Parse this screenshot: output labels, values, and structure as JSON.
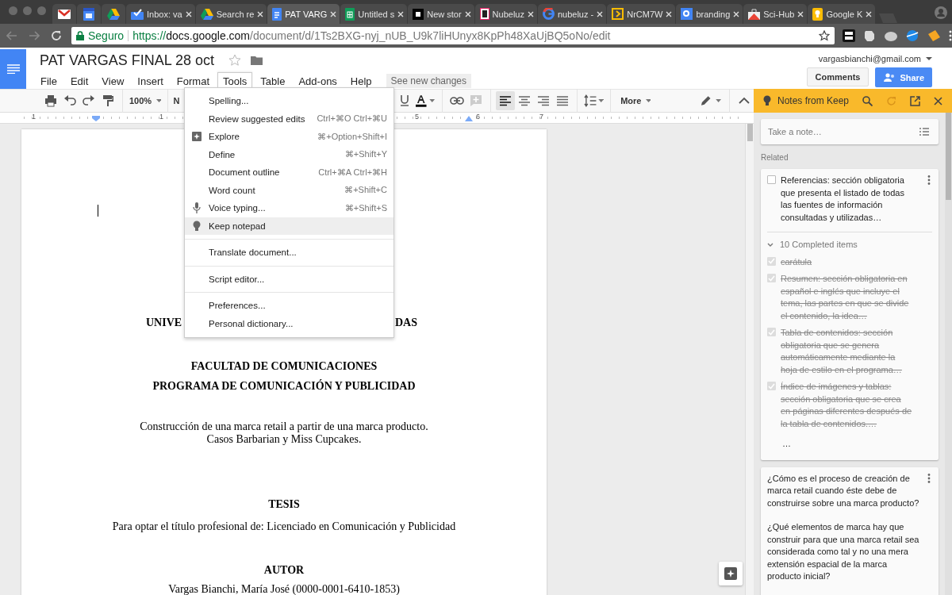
{
  "browser": {
    "tabs": [
      {
        "kind": "gmail",
        "selected": false
      },
      {
        "kind": "calendar",
        "selected": false
      },
      {
        "kind": "drive",
        "selected": false
      },
      {
        "kind": "inbox",
        "title": "Inbox: va",
        "selected": false
      },
      {
        "kind": "drive",
        "title": "Search re",
        "selected": false
      },
      {
        "kind": "docs",
        "title": "PAT VARG",
        "selected": true
      },
      {
        "kind": "sheets",
        "title": "Untitled s",
        "selected": false
      },
      {
        "kind": "medium",
        "title": "New stor",
        "selected": false
      },
      {
        "kind": "nubeluz",
        "title": "Nubeluz",
        "selected": false
      },
      {
        "kind": "google",
        "title": "nubeluz -",
        "selected": false
      },
      {
        "kind": "slides",
        "title": "NrCM7W",
        "selected": false
      },
      {
        "kind": "gsearch",
        "title": "branding",
        "selected": false
      },
      {
        "kind": "scihub",
        "title": "Sci-Hub",
        "selected": false
      },
      {
        "kind": "keep",
        "title": "Google K",
        "selected": false
      }
    ],
    "security": "Seguro",
    "url": {
      "scheme": "https://",
      "host": "docs.google.com",
      "path": "/document/d/1Ts2BXG-nyj_nUB_U9k7liHUnyx8KpPh48XaUjBQ5oNo/edit"
    }
  },
  "document": {
    "title": "PAT VARGAS FINAL 28 oct",
    "starred": false,
    "menus": [
      {
        "label": "File",
        "selected": false
      },
      {
        "label": "Edit",
        "selected": false
      },
      {
        "label": "View",
        "selected": false
      },
      {
        "label": "Insert",
        "selected": false
      },
      {
        "label": "Format",
        "selected": false
      },
      {
        "label": "Tools",
        "selected": true
      },
      {
        "label": "Table",
        "selected": false
      },
      {
        "label": "Add-ons",
        "selected": false
      },
      {
        "label": "Help",
        "selected": false
      }
    ],
    "notice": "See new changes",
    "account": "vargasbianchi@gmail.com",
    "comments": "Comments",
    "share": "Share"
  },
  "toolbar": {
    "zoom": "100%",
    "style": "N",
    "more": "More",
    "alignment": [
      {
        "selected": true
      },
      {
        "selected": false
      },
      {
        "selected": false
      },
      {
        "selected": false
      }
    ]
  },
  "ruler": [
    "1",
    "1",
    "5",
    "6",
    "7"
  ],
  "tools_menu": {
    "groups": [
      [
        {
          "kind": "plain",
          "label": "Spelling...",
          "selected": false
        },
        {
          "kind": "plain",
          "label": "Review suggested edits",
          "shortcut": "Ctrl+⌘O Ctrl+⌘U",
          "selected": false
        },
        {
          "kind": "explore",
          "label": "Explore",
          "shortcut": "⌘+Option+Shift+I",
          "selected": false
        },
        {
          "kind": "plain",
          "label": "Define",
          "shortcut": "⌘+Shift+Y",
          "selected": false
        },
        {
          "kind": "plain",
          "label": "Document outline",
          "shortcut": "Ctrl+⌘A Ctrl+⌘H",
          "selected": false
        },
        {
          "kind": "plain",
          "label": "Word count",
          "shortcut": "⌘+Shift+C",
          "selected": false
        },
        {
          "kind": "voice",
          "label": "Voice typing...",
          "shortcut": "⌘+Shift+S",
          "selected": false
        },
        {
          "kind": "keep",
          "label": "Keep notepad",
          "selected": true
        }
      ],
      [
        {
          "kind": "plain",
          "label": "Translate document...",
          "selected": false
        }
      ],
      [
        {
          "kind": "plain",
          "label": "Script editor...",
          "selected": false
        }
      ],
      [
        {
          "kind": "plain",
          "label": "Preferences...",
          "selected": false
        },
        {
          "kind": "plain",
          "label": "Personal dictionary...",
          "selected": false
        }
      ]
    ]
  },
  "page": {
    "lines": [
      {
        "kind": "split",
        "parts": [
          "UNIVE",
          "DAS"
        ]
      },
      {
        "kind": "heading",
        "text": "FACULTAD DE COMUNICACIONES"
      },
      {
        "kind": "heading",
        "text": "PROGRAMA DE COMUNICACIÓN Y PUBLICIDAD"
      },
      {
        "kind": "body",
        "text": "Construcción de una marca retail a partir de una marca producto."
      },
      {
        "kind": "body",
        "text": "Casos Barbarian y Miss Cupcakes."
      },
      {
        "kind": "heading",
        "text": "TESIS"
      },
      {
        "kind": "body",
        "text": "Para optar el título profesional de: Licenciado en Comunicación y Publicidad"
      },
      {
        "kind": "heading",
        "text": "AUTOR"
      },
      {
        "kind": "body",
        "text": "Vargas Bianchi, María José (0000-0001-6410-1853)"
      }
    ]
  },
  "keep": {
    "title": "Notes from Keep",
    "placeholder": "Take a note…",
    "section": "Related",
    "notes": [
      {
        "kind": "list",
        "items": [
          {
            "text": "Referencias: sección obligatoria que presenta el listado de todas las fuentes de información consultadas y utilizadas…",
            "checked": false
          }
        ],
        "completed": {
          "label": "10 Completed items",
          "expanded": true,
          "items": [
            {
              "text": "carátula",
              "checked": true
            },
            {
              "text": "Resumen: sección obligatoria en español e inglés que incluye el tema, las partes en que se divide el contenido, la idea…",
              "checked": true
            },
            {
              "text": "Tabla de contenidos: sección obligatoria que se genera automáticamente mediante la hoja de estilo en el programa…",
              "checked": true
            },
            {
              "text": "Índice de imágenes y tablas: sección obligatoria que se crea en páginas diferentes después de la tabla de contenidos.…",
              "checked": true
            }
          ],
          "more": "…"
        }
      },
      {
        "kind": "text",
        "paragraphs": [
          "¿Cómo es el proceso de creación de marca retail cuando éste debe de construirse sobre una marca producto?",
          "¿Qué elementos de marca hay que construir para que una marca retail sea considerada como tal y no una mera extensión espacial de la marca producto inicial?"
        ]
      }
    ]
  }
}
